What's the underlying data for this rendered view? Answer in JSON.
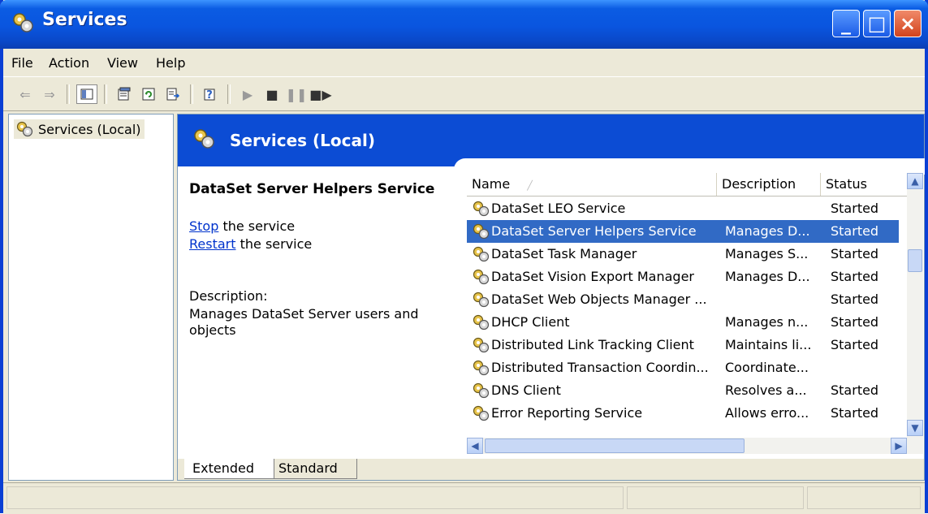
{
  "window": {
    "title": "Services",
    "controls": [
      "minimize-icon",
      "maximize-icon",
      "close-icon"
    ]
  },
  "menu": {
    "items": [
      "File",
      "Action",
      "View",
      "Help"
    ]
  },
  "toolbar": {
    "icons": [
      "back-arrow-icon",
      "forward-arrow-icon",
      "show-hide-tree-icon",
      "properties-icon",
      "refresh-icon",
      "export-list-icon",
      "help-icon",
      "start-service-icon",
      "stop-service-icon",
      "pause-service-icon",
      "restart-service-icon"
    ]
  },
  "tree": {
    "root_label": "Services (Local)"
  },
  "header": {
    "title": "Services (Local)",
    "band_color": "#0c4cd4"
  },
  "detail": {
    "service_name": "DataSet Server Helpers Service",
    "stop_link": "Stop",
    "stop_suffix": " the service",
    "restart_link": "Restart",
    "restart_suffix": " the service",
    "description_label": "Description:",
    "description_text": "Manages DataSet Server users and objects"
  },
  "list": {
    "columns": [
      "Name",
      "Description",
      "Status"
    ],
    "rows": [
      {
        "name": "DataSet LEO Service",
        "description": "",
        "status": "Started",
        "selected": false
      },
      {
        "name": "DataSet Server Helpers Service",
        "description": "Manages D...",
        "status": "Started",
        "selected": true
      },
      {
        "name": "DataSet Task Manager",
        "description": "Manages S...",
        "status": "Started",
        "selected": false
      },
      {
        "name": "DataSet Vision Export Manager",
        "description": "Manages D...",
        "status": "Started",
        "selected": false
      },
      {
        "name": "DataSet Web Objects Manager ...",
        "description": "",
        "status": "Started",
        "selected": false
      },
      {
        "name": "DHCP Client",
        "description": "Manages n...",
        "status": "Started",
        "selected": false
      },
      {
        "name": "Distributed Link Tracking Client",
        "description": "Maintains li...",
        "status": "Started",
        "selected": false
      },
      {
        "name": "Distributed Transaction Coordin...",
        "description": "Coordinate...",
        "status": "",
        "selected": false
      },
      {
        "name": "DNS Client",
        "description": "Resolves a...",
        "status": "Started",
        "selected": false
      },
      {
        "name": "Error Reporting Service",
        "description": "Allows erro...",
        "status": "Started",
        "selected": false
      }
    ]
  },
  "tabs": {
    "extended": "Extended",
    "standard": "Standard"
  }
}
